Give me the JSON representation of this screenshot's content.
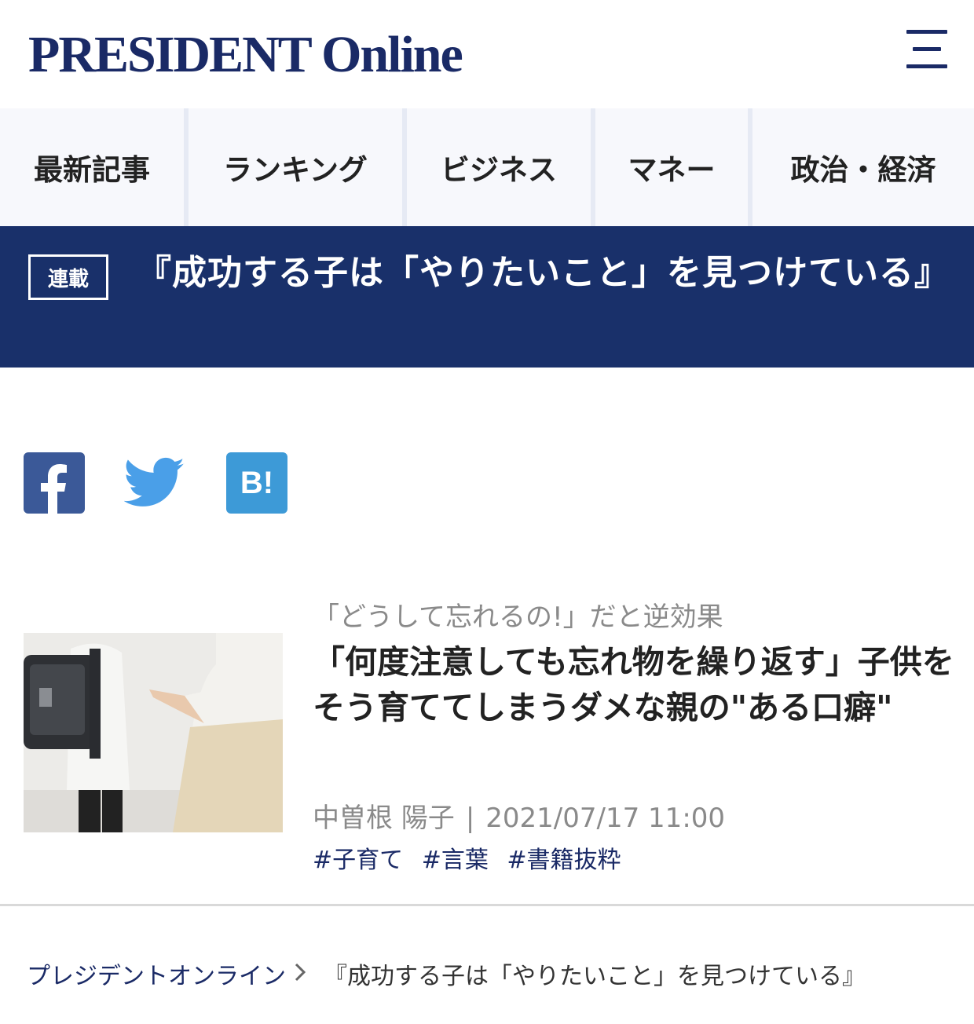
{
  "header": {
    "logo_text": "PRESIDENT Online",
    "menu_icon": "hamburger-menu-icon"
  },
  "nav": {
    "items": [
      {
        "label": "最新記事"
      },
      {
        "label": "ランキング"
      },
      {
        "label": "ビジネス"
      },
      {
        "label": "マネー"
      },
      {
        "label": "政治・経済"
      }
    ]
  },
  "series": {
    "badge": "連載",
    "title": "『成功する子は「やりたいこと」を見つけている』"
  },
  "social": {
    "facebook_icon": "facebook-icon",
    "twitter_icon": "twitter-icon",
    "hatena_label": "B!"
  },
  "article": {
    "kicker": "「どうして忘れるの!」だと逆効果",
    "headline": "「何度注意しても忘れ物を繰り返す」子供をそう育ててしまうダメな親の\"ある口癖\"",
    "author": "中曽根 陽子",
    "separator": "|",
    "datetime": "2021/07/17 11:00",
    "tags": [
      "#子育て",
      "#言葉",
      "#書籍抜粋"
    ]
  },
  "breadcrumb": {
    "home": "プレジデントオンライン",
    "current": "『成功する子は「やりたいこと」を見つけている』"
  },
  "colors": {
    "brand_navy": "#19306a",
    "facebook": "#3b5998",
    "twitter": "#4a9fe8",
    "hatena": "#3d9ad7"
  }
}
